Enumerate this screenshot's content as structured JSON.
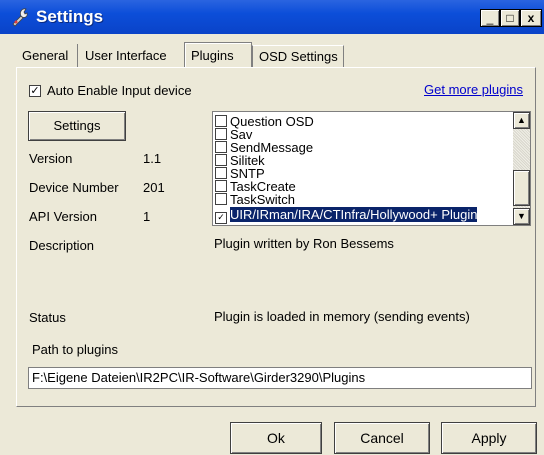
{
  "window": {
    "title": "Settings",
    "minimize_glyph": "_",
    "maximize_glyph": "□",
    "close_glyph": "x"
  },
  "tabs": [
    {
      "label": "General",
      "active": false
    },
    {
      "label": "User Interface",
      "active": false
    },
    {
      "label": "Plugins",
      "active": true
    },
    {
      "label": "OSD Settings",
      "active": false
    }
  ],
  "plugins": {
    "auto_enable_label": "Auto Enable Input device",
    "auto_enable_checked": true,
    "get_more_link": "Get more plugins",
    "settings_button": "Settings",
    "version_label": "Version",
    "version_value": "1.1",
    "device_number_label": "Device Number",
    "device_number_value": "201",
    "api_version_label": "API Version",
    "api_version_value": "1",
    "description_label": "Description",
    "description_value": "Plugin written by Ron Bessems",
    "status_label": "Status",
    "status_value": "Plugin is loaded in memory (sending events)",
    "path_label": "Path to plugins",
    "path_value": "F:\\Eigene Dateien\\IR2PC\\IR-Software\\Girder3290\\Plugins",
    "list": [
      {
        "label": "Question OSD",
        "checked": false,
        "selected": false
      },
      {
        "label": "Sav",
        "checked": false,
        "selected": false
      },
      {
        "label": "SendMessage",
        "checked": false,
        "selected": false
      },
      {
        "label": "Silitek",
        "checked": false,
        "selected": false
      },
      {
        "label": "SNTP",
        "checked": false,
        "selected": false
      },
      {
        "label": "TaskCreate",
        "checked": false,
        "selected": false
      },
      {
        "label": "TaskSwitch",
        "checked": false,
        "selected": false
      },
      {
        "label": "UIR/IRman/IRA/CTInfra/Hollywood+ Plugin",
        "checked": true,
        "selected": true
      }
    ]
  },
  "buttons": {
    "ok": "Ok",
    "cancel": "Cancel",
    "apply": "Apply"
  },
  "colors": {
    "titlebar": "#0c4ed9",
    "face": "#ece9d8",
    "selection": "#0a246a",
    "link": "#0000cc"
  }
}
